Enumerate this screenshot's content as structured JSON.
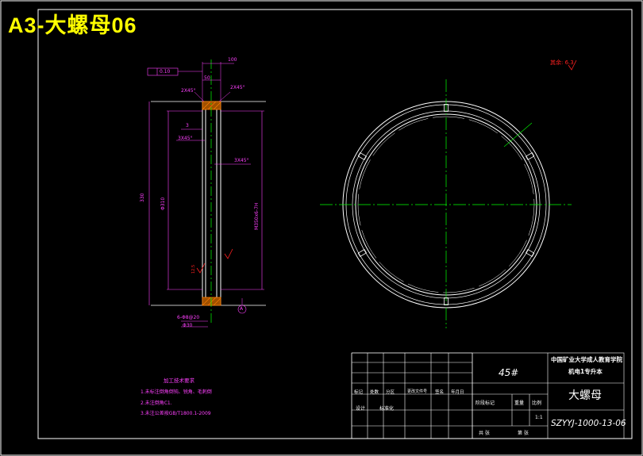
{
  "title": "A3-大螺母06",
  "colors": {
    "background": "#000000",
    "title": "#ffff00",
    "outline": "#ffffff",
    "centerline": "#00ff00",
    "dimension": "#ff40ff",
    "section": "#ff7f00",
    "roughness": "#ff2020"
  },
  "drawing": {
    "roughness_label": "其余:",
    "roughness_value": "6.3",
    "dimensions": {
      "top_width": "100",
      "inner_width": "50",
      "chamfer_left": "2X45°",
      "chamfer_right": "2X45°",
      "groove": "3",
      "groove_chamfer": "3X45°",
      "thread_chamfer": "3X45°",
      "total_height": "330",
      "bore_dia": "Φ310",
      "thread_spec": "M350x6-7H",
      "bottom_1": "6-Φ8@20",
      "bottom_2": "Φ30",
      "tolerance_box": "0.10",
      "datum": "A",
      "roughness_side": "12.5"
    }
  },
  "requirements": {
    "title": "加工技术要求",
    "items": [
      "1.未标注倒角倒钝、锐角、毛刺倒",
      "2.未注倒角C1.",
      "3.未注公差按GB/T1800.1-2009"
    ]
  },
  "title_block": {
    "material": "45#",
    "school_line1": "中国矿业大学成人教育学院",
    "school_line2": "机电1专升本",
    "part_name": "大螺母",
    "drawing_no": "SZYYJ-1000-13-06",
    "scale_label": "1:1",
    "row_labels": [
      "标记",
      "处数",
      "分区",
      "更改文件号",
      "签名",
      "年月日"
    ],
    "design_label": "设计",
    "standard_label": "标准化",
    "stage_label": "阶段标记",
    "weight_label": "重量",
    "ratio_label": "比例",
    "sheet_total": "共 张",
    "sheet_no": "第 张"
  }
}
